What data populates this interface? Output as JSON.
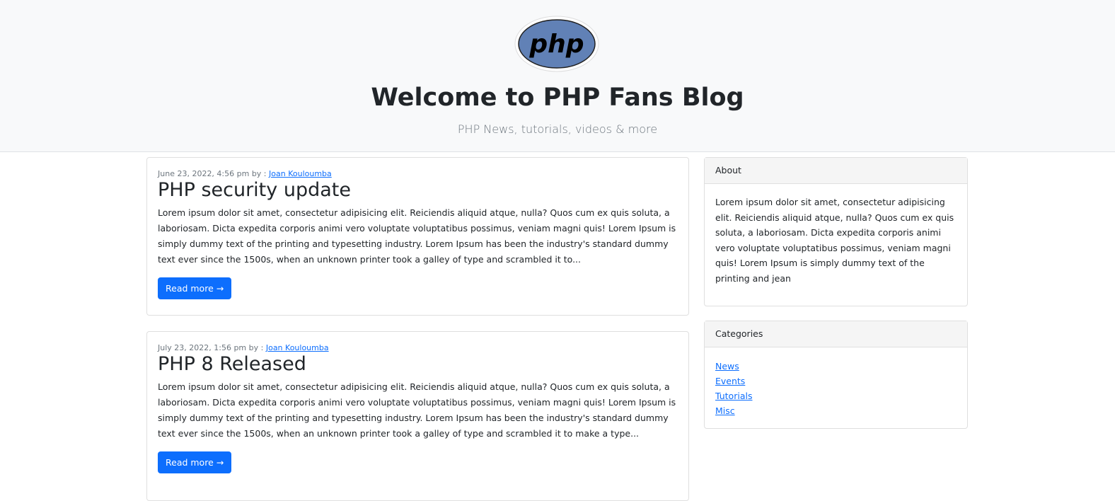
{
  "header": {
    "logo_text": "php",
    "title": "Welcome to PHP Fans Blog",
    "subtitle": "PHP News, tutorials, videos & more"
  },
  "posts": [
    {
      "date": "June 23, 2022, 4:56 pm by : ",
      "author": "Joan Kouloumba",
      "title": "PHP security update",
      "excerpt": "Lorem ipsum dolor sit amet, consectetur adipisicing elit. Reiciendis aliquid atque, nulla? Quos cum ex quis soluta, a laboriosam. Dicta expedita corporis animi vero voluptate voluptatibus possimus, veniam magni quis! Lorem Ipsum is simply dummy text of the printing and typesetting industry. Lorem Ipsum has been the industry's standard dummy text ever since the 1500s, when an unknown printer took a galley of type and scrambled it to...",
      "button": "Read more →"
    },
    {
      "date": "July 23, 2022, 1:56 pm by : ",
      "author": "Joan Kouloumba",
      "title": "PHP 8 Released",
      "excerpt": "Lorem ipsum dolor sit amet, consectetur adipisicing elit. Reiciendis aliquid atque, nulla? Quos cum ex quis soluta, a laboriosam. Dicta expedita corporis animi vero voluptate voluptatibus possimus, veniam magni quis! Lorem Ipsum is simply dummy text of the printing and typesetting industry. Lorem Ipsum has been the industry's standard dummy text ever since the 1500s, when an unknown printer took a galley of type and scrambled it to make a type...",
      "button": "Read more →"
    }
  ],
  "sidebar": {
    "about": {
      "title": "About",
      "text": "Lorem ipsum dolor sit amet, consectetur adipisicing elit. Reiciendis aliquid atque, nulla? Quos cum ex quis soluta, a laboriosam. Dicta expedita corporis animi vero voluptate voluptatibus possimus, veniam magni quis! Lorem Ipsum is simply dummy text of the printing and jean"
    },
    "categories": {
      "title": "Categories",
      "items": [
        "News",
        "Events",
        "Tutorials",
        "Misc"
      ]
    }
  }
}
